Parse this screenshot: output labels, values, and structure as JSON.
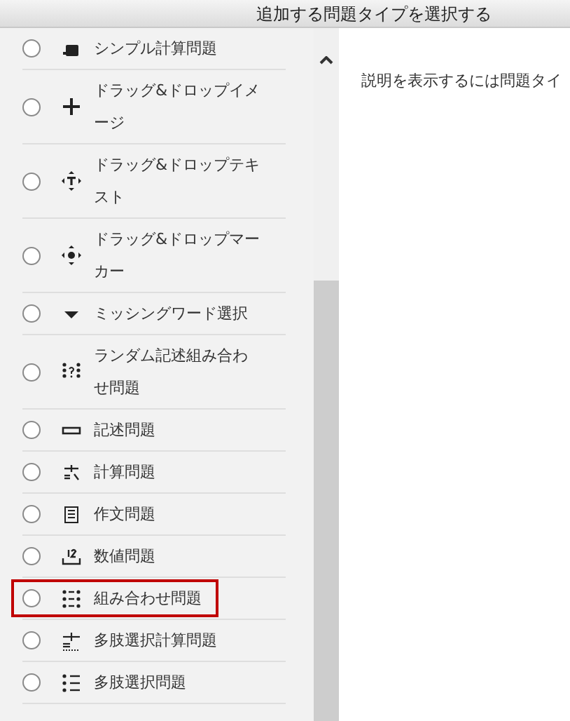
{
  "dialog": {
    "title": "追加する問題タイプを選択する"
  },
  "question_types": [
    {
      "label": "シンプル計算問題",
      "highlighted": false
    },
    {
      "label": "ドラッグ&ドロップイメージ",
      "highlighted": false
    },
    {
      "label": "ドラッグ&ドロップテキスト",
      "highlighted": false
    },
    {
      "label": "ドラッグ&ドロップマーカー",
      "highlighted": false
    },
    {
      "label": "ミッシングワード選択",
      "highlighted": false
    },
    {
      "label": "ランダム記述組み合わせ問題",
      "highlighted": false
    },
    {
      "label": "記述問題",
      "highlighted": false
    },
    {
      "label": "計算問題",
      "highlighted": false
    },
    {
      "label": "作文問題",
      "highlighted": false
    },
    {
      "label": "数値問題",
      "highlighted": false
    },
    {
      "label": "組み合わせ問題",
      "highlighted": true
    },
    {
      "label": "多肢選択計算問題",
      "highlighted": false
    },
    {
      "label": "多肢選択問題",
      "highlighted": false
    }
  ],
  "description": {
    "text": "説明を表示するには問題タイ"
  }
}
